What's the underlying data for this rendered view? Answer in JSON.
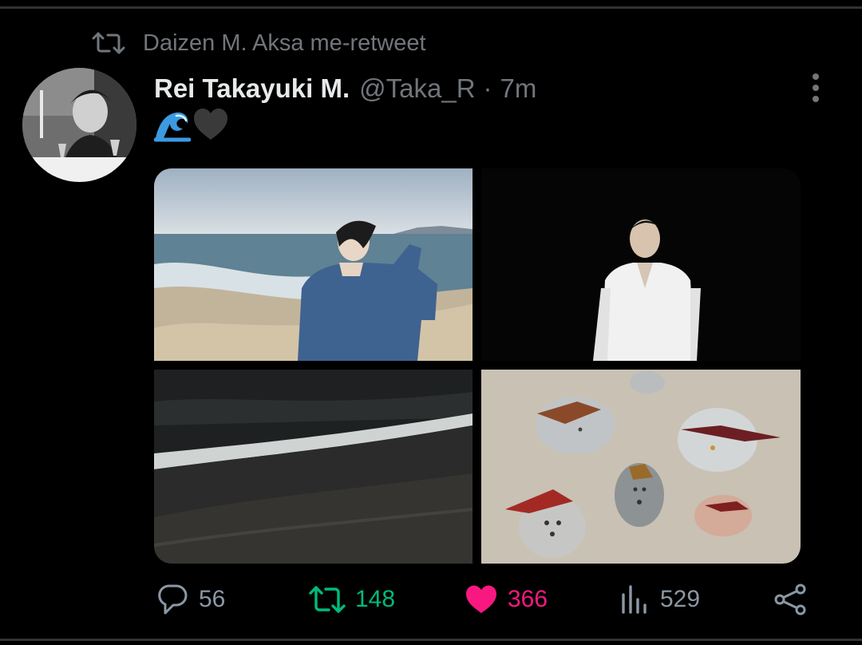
{
  "retweet_notice": {
    "text": "Daizen M. Aksa me-retweet",
    "icon": "retweet-icon"
  },
  "tweet": {
    "author_name": "Rei Takayuki M.",
    "handle": "@Taka_R",
    "separator": "·",
    "time": "7m",
    "text_emojis": [
      "wave-emoji",
      "black-heart-emoji"
    ],
    "media": [
      {
        "name": "beach-denim-photo"
      },
      {
        "name": "night-white-shirt-photo"
      },
      {
        "name": "night-waves-photo"
      },
      {
        "name": "stone-faces-photo"
      }
    ]
  },
  "actions": {
    "reply_count": "56",
    "retweet_count": "148",
    "like_count": "366",
    "view_count": "529"
  },
  "colors": {
    "background": "#000000",
    "text_primary": "#e7e9ea",
    "text_secondary": "#71767b",
    "retweet_active": "#00ba7c",
    "like_active": "#f91880"
  }
}
